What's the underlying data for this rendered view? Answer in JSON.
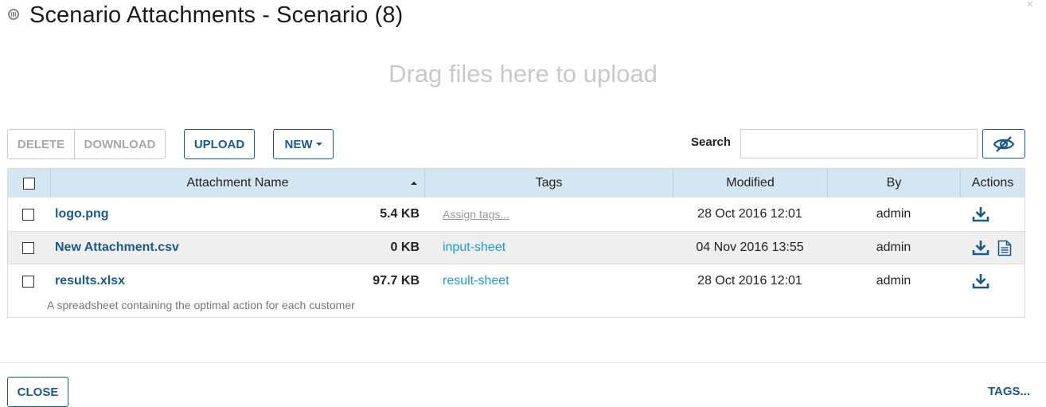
{
  "dialog": {
    "title": "Scenario Attachments - Scenario (8)",
    "close_glyph": "×",
    "dropzone_text": "Drag files here to upload"
  },
  "toolbar": {
    "delete_label": "DELETE",
    "download_label": "DOWNLOAD",
    "upload_label": "UPLOAD",
    "new_label": "NEW",
    "search_label": "Search",
    "search_value": "",
    "hide_icon": "eye-slash-icon"
  },
  "table": {
    "columns": [
      "Attachment Name",
      "Tags",
      "Modified",
      "By",
      "Actions"
    ],
    "rows": [
      {
        "name": "logo.png",
        "size": "5.4 KB",
        "tag": "Assign tags...",
        "modified": "28 Oct 2016 12:01",
        "by": "admin"
      },
      {
        "name": "New Attachment.csv",
        "size": "0 KB",
        "tag": "input-sheet",
        "modified": "04 Nov 2016 13:55",
        "by": "admin"
      },
      {
        "name": "results.xlsx",
        "size": "97.7 KB",
        "tag": "result-sheet",
        "modified": "28 Oct 2016 12:01",
        "by": "admin",
        "description": "A spreadsheet containing the optimal action for each customer"
      }
    ]
  },
  "footer": {
    "close_label": "CLOSE",
    "tags_label": "TAGS..."
  },
  "colors": {
    "primary": "#1a5a8a",
    "tag_link": "#1a9ad6",
    "header_bg": "#d3e6f2",
    "alt_row_bg": "#efefef"
  }
}
